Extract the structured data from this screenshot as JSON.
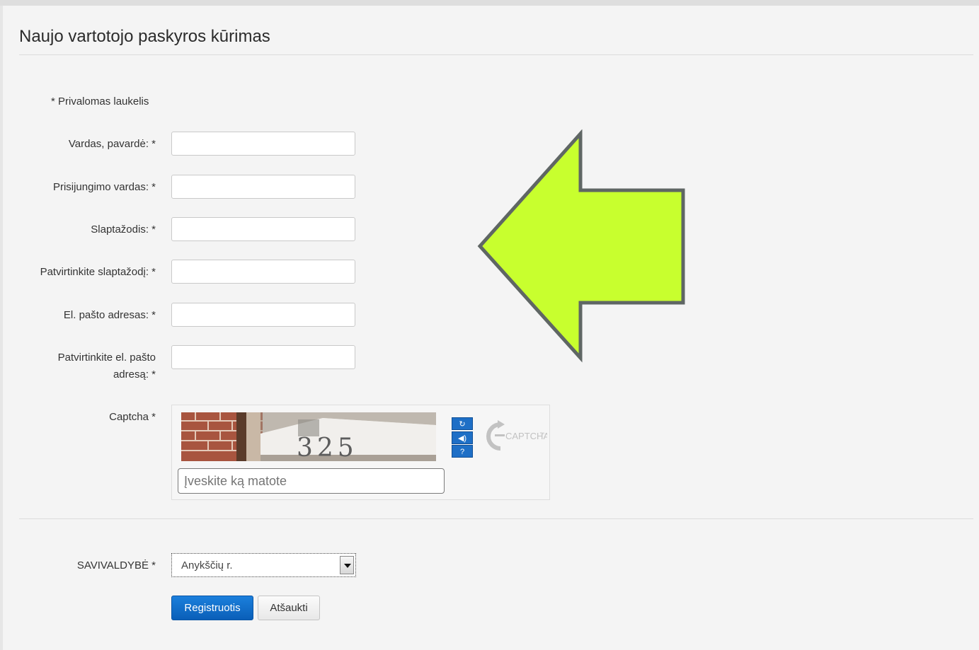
{
  "page": {
    "title": "Naujo vartotojo paskyros kūrimas",
    "required_note": "* Privalomas laukelis"
  },
  "form": {
    "fields": [
      {
        "label": "Vardas, pavardė: *",
        "value": ""
      },
      {
        "label": "Prisijungimo vardas: *",
        "value": ""
      },
      {
        "label": "Slaptažodis: *",
        "value": ""
      },
      {
        "label": "Patvirtinkite slaptažodį: *",
        "value": ""
      },
      {
        "label": "El. pašto adresas: *",
        "value": ""
      },
      {
        "label_line1": "Patvirtinkite el. pašto",
        "label_line2": "adresą: *",
        "value": ""
      }
    ],
    "captcha": {
      "label": "Captcha *",
      "image_text": "325",
      "placeholder": "Įveskite ką matote",
      "logo_text": "CAPTCHA",
      "logo_tm": "™",
      "refresh_icon": "refresh-icon",
      "audio_icon": "audio-icon",
      "help_icon": "help-icon"
    },
    "municipality": {
      "label": "SAVIVALDYBĖ *",
      "selected": "Anykščių r."
    },
    "buttons": {
      "submit": "Registruotis",
      "cancel": "Atšaukti"
    }
  },
  "colors": {
    "primary": "#0a5fb8",
    "arrow_fill": "#c8ff2e",
    "arrow_stroke": "#5f6664",
    "captcha_button": "#1e6fc6"
  }
}
